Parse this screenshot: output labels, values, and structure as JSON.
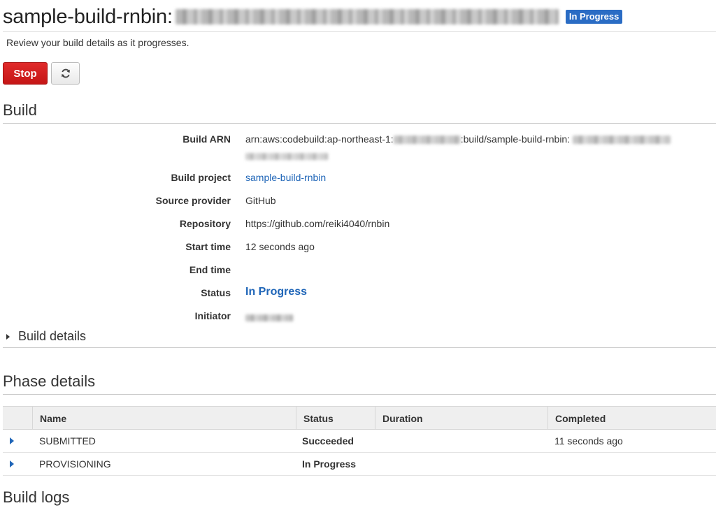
{
  "header": {
    "title": "sample-build-rnbin:",
    "status_badge": "In Progress",
    "subtitle": "Review your build details as it progresses."
  },
  "toolbar": {
    "stop_label": "Stop",
    "refresh_icon": "refresh-icon"
  },
  "build_section": {
    "title": "Build",
    "fields": {
      "arn_label": "Build ARN",
      "arn_prefix": "arn:aws:codebuild:ap-northeast-1:",
      "arn_middle": ":build/sample-build-rnbin:",
      "project_label": "Build project",
      "project_value": "sample-build-rnbin",
      "source_label": "Source provider",
      "source_value": "GitHub",
      "repo_label": "Repository",
      "repo_value": "https://github.com/reiki4040/rnbin",
      "start_label": "Start time",
      "start_value": "12 seconds ago",
      "end_label": "End time",
      "end_value": "",
      "status_label": "Status",
      "status_value": "In Progress",
      "initiator_label": "Initiator"
    },
    "details_toggle": "Build details"
  },
  "phase_section": {
    "title": "Phase details",
    "columns": [
      "Name",
      "Status",
      "Duration",
      "Completed"
    ],
    "rows": [
      {
        "name": "SUBMITTED",
        "status": "Succeeded",
        "duration": "",
        "completed": "11 seconds ago"
      },
      {
        "name": "PROVISIONING",
        "status": "In Progress",
        "duration": "",
        "completed": ""
      }
    ]
  },
  "logs_section": {
    "title": "Build logs"
  },
  "colors": {
    "accent_blue": "#2066b8",
    "badge_blue": "#2a6cc4",
    "stop_red": "#d41f1f",
    "success_green": "#2a9a2a"
  }
}
